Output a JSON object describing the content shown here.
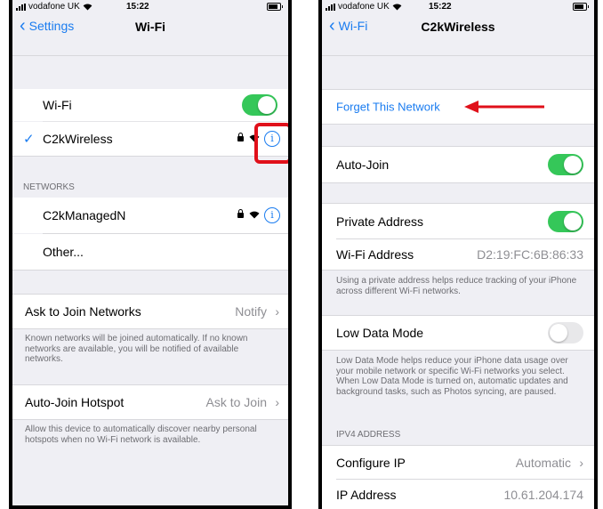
{
  "left": {
    "status": {
      "carrier": "vodafone UK",
      "time": "15:22"
    },
    "nav": {
      "back": "Settings",
      "title": "Wi-Fi"
    },
    "wifi_label": "Wi-Fi",
    "connected_network": "C2kWireless",
    "checkmark": "✓",
    "networks_header": "NETWORKS",
    "networks": [
      "C2kManagedN",
      "Other..."
    ],
    "ask_join": {
      "label": "Ask to Join Networks",
      "value": "Notify"
    },
    "ask_join_footer": "Known networks will be joined automatically. If no known networks are available, you will be notified of available networks.",
    "hotspot": {
      "label": "Auto-Join Hotspot",
      "value": "Ask to Join"
    },
    "hotspot_footer": "Allow this device to automatically discover nearby personal hotspots when no Wi-Fi network is available.",
    "info_glyph": "i",
    "chevron": "›"
  },
  "right": {
    "status": {
      "carrier": "vodafone UK",
      "time": "15:22"
    },
    "nav": {
      "back": "Wi-Fi",
      "title": "C2kWireless"
    },
    "forget": "Forget This Network",
    "auto_join": "Auto-Join",
    "private_address": "Private Address",
    "wifi_address": {
      "label": "Wi-Fi Address",
      "value": "D2:19:FC:6B:86:33"
    },
    "private_footer": "Using a private address helps reduce tracking of your iPhone across different Wi-Fi networks.",
    "low_data": "Low Data Mode",
    "low_data_footer": "Low Data Mode helps reduce your iPhone data usage over your mobile network or specific Wi-Fi networks you select. When Low Data Mode is turned on, automatic updates and background tasks, such as Photos syncing, are paused.",
    "ipv4_header": "IPV4 ADDRESS",
    "configure_ip": {
      "label": "Configure IP",
      "value": "Automatic"
    },
    "ip_address": {
      "label": "IP Address",
      "value": "10.61.204.174"
    },
    "chevron": "›"
  },
  "toggles": {
    "wifi": true,
    "auto_join": true,
    "private_address": true,
    "low_data": false
  },
  "colors": {
    "accent": "#1a7cf0",
    "toggle_on": "#35c759",
    "highlight": "#e0101a"
  }
}
